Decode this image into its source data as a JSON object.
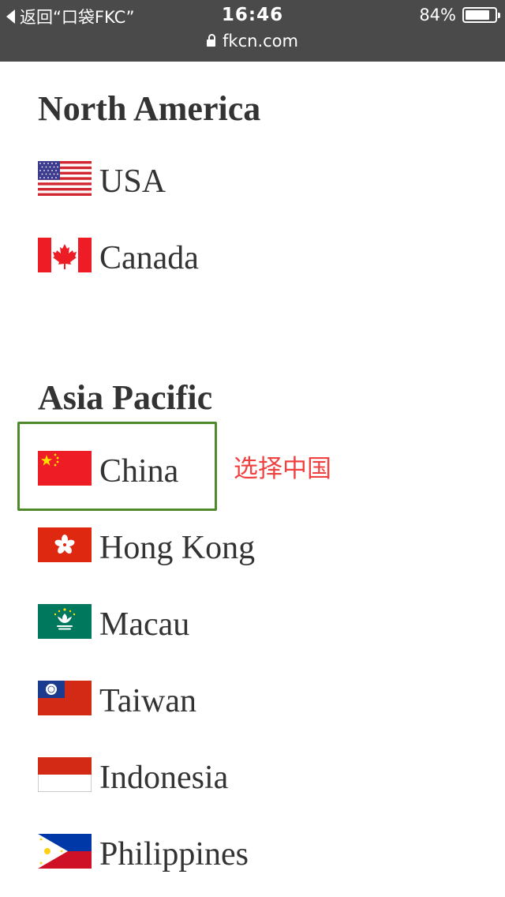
{
  "status_bar": {
    "back_label": "返回“口袋FKC”",
    "time": "16:46",
    "battery_percent_text": "84%",
    "battery_level": 0.84,
    "url": "fkcn.com"
  },
  "sections": [
    {
      "title": "North America",
      "countries": [
        {
          "name": "USA",
          "flag": "flag-usa"
        },
        {
          "name": "Canada",
          "flag": "flag-canada"
        }
      ]
    },
    {
      "title": "Asia Pacific",
      "countries": [
        {
          "name": "China",
          "flag": "flag-china"
        },
        {
          "name": "Hong Kong",
          "flag": "flag-hong-kong"
        },
        {
          "name": "Macau",
          "flag": "flag-macau"
        },
        {
          "name": "Taiwan",
          "flag": "flag-taiwan"
        },
        {
          "name": "Indonesia",
          "flag": "flag-indonesia"
        },
        {
          "name": "Philippines",
          "flag": "flag-philippines"
        }
      ]
    }
  ],
  "annotation": {
    "text": "选择中国",
    "color": "#f04040"
  },
  "highlight_color": "#4e8a2a"
}
